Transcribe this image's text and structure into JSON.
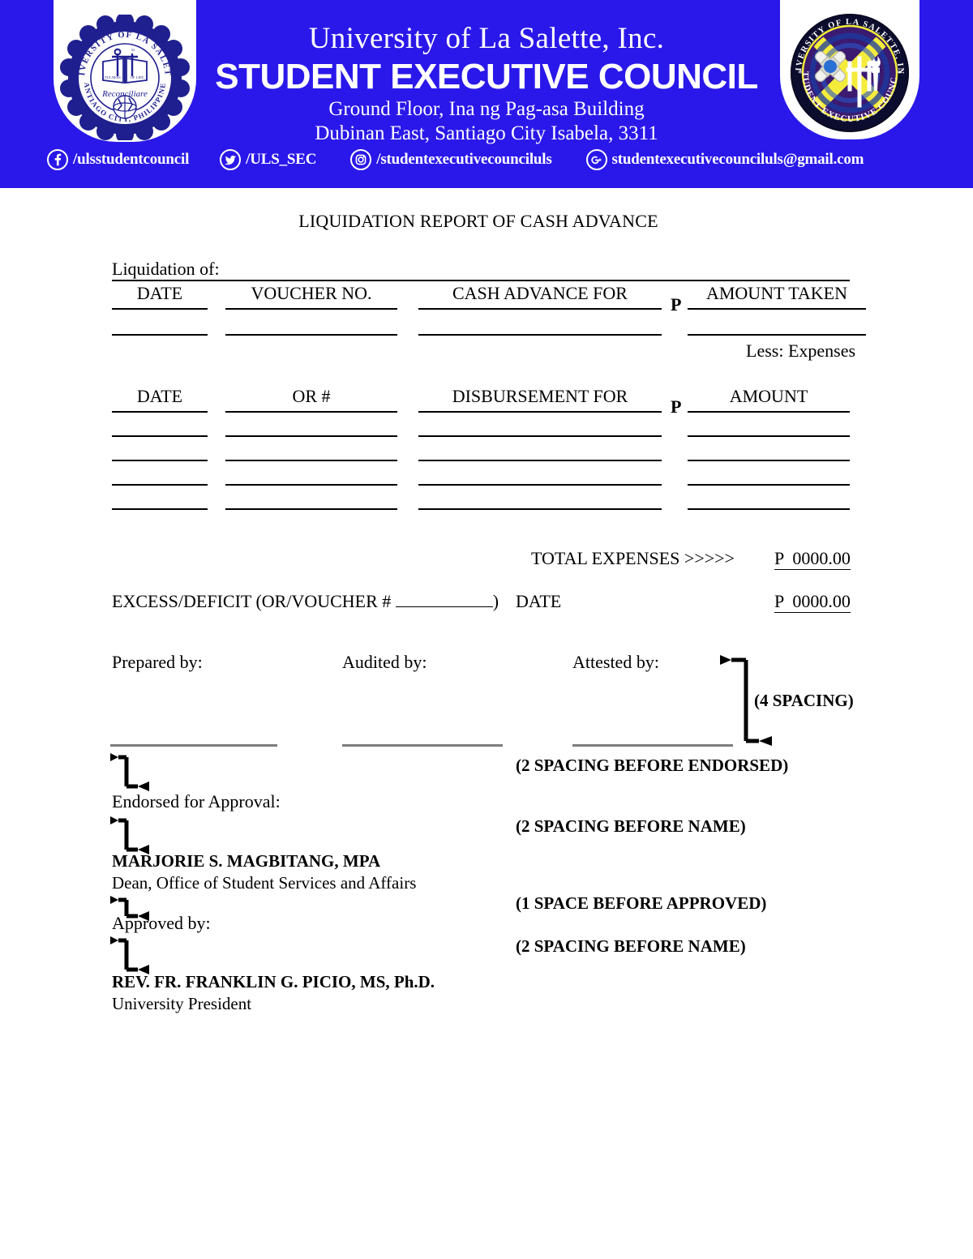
{
  "header": {
    "org_line1": "University of La Salette, Inc.",
    "org_line2": "STUDENT EXECUTIVE COUNCIL",
    "address_line1": "Ground Floor, Ina ng Pag-asa Building",
    "address_line2": "Dubinan East, Santiago City Isabela, 3311",
    "banner_color": "#2a18ea",
    "left_seal": {
      "icon": "university-seal-icon",
      "outer_text_top": "UNIVERSITY OF LA SALETTE",
      "outer_text_bottom": "SANTIAGO CITY, PHILIPPINES",
      "motto": "Reconciliare",
      "year": "1952",
      "book_text_left": "FULNESS",
      "book_text_right": "OF LIFE"
    },
    "right_seal": {
      "icon": "student-executive-council-seal-icon",
      "outer_text_top": "UNIVERSITY OF LA SALETTE, INC.",
      "outer_text_bottom": "STUDENT EXECUTIVE COUNCIL"
    },
    "socials": [
      {
        "icon": "facebook-icon",
        "label": "/ulsstudentcouncil"
      },
      {
        "icon": "twitter-icon",
        "label": "/ULS_SEC"
      },
      {
        "icon": "instagram-icon",
        "label": "/studentexecutivecounciluls"
      },
      {
        "icon": "google-plus-icon",
        "label": "studentexecutivecounciluls@gmail.com"
      }
    ]
  },
  "document": {
    "title": "LIQUIDATION REPORT OF CASH ADVANCE",
    "liquidation_of_label": "Liquidation of:"
  },
  "advance_table": {
    "headers": [
      "DATE",
      "VOUCHER NO.",
      "CASH ADVANCE FOR",
      "AMOUNT TAKEN"
    ],
    "currency_symbol": "P",
    "rows": 1,
    "less_label": "Less:   Expenses"
  },
  "disbursement_table": {
    "headers": [
      "DATE",
      "OR #",
      "DISBURSEMENT FOR",
      "AMOUNT"
    ],
    "currency_symbol": "P",
    "rows": 4
  },
  "totals": {
    "total_expenses_label": "TOTAL EXPENSES >>>>>",
    "total_expenses_value": "P  0000.00",
    "excess_deficit_label_a": "EXCESS/DEFICIT (OR/VOUCHER # ",
    "excess_deficit_label_b": ")",
    "date_label": "DATE",
    "excess_deficit_value": "P  0000.00"
  },
  "signatures": {
    "prepared_by": "Prepared by:",
    "audited_by": "Audited by:",
    "attested_by": "Attested by:",
    "endorsed_for_approval": "Endorsed for Approval:",
    "approved_by": "Approved by:",
    "dean_name": "MARJORIE S. MAGBITANG, MPA",
    "dean_title": "Dean, Office of Student Services and Affairs",
    "president_name": "REV. FR. FRANKLIN G. PICIO, MS, Ph.D.",
    "president_title": "University President"
  },
  "spacing_notes": {
    "note_4_spacing": "(4 SPACING)",
    "note_2_before_endorsed": "(2 SPACING BEFORE ENDORSED)",
    "note_2_before_name_1": "(2 SPACING BEFORE NAME)",
    "note_1_before_approved": "(1 SPACE BEFORE APPROVED)",
    "note_2_before_name_2": "(2 SPACING BEFORE NAME)"
  }
}
